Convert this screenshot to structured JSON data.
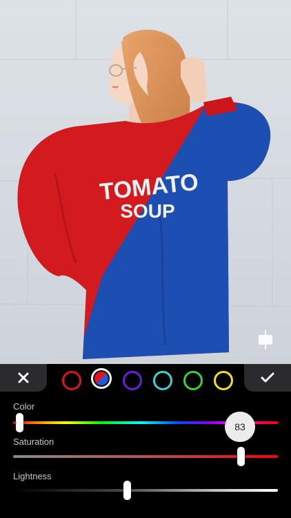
{
  "photo": {
    "description": "",
    "sweatshirt_text_line1": "TOMATO",
    "sweatshirt_text_line2": "SOUP",
    "original_color": "#d21a1f",
    "recolor_color": "#1d4fb3"
  },
  "toolbar": {
    "cancel_icon": "close-icon",
    "confirm_icon": "checkmark-icon",
    "swatches": [
      {
        "name": "red",
        "color": "#e1141e"
      },
      {
        "name": "red-blue",
        "color": "#1e5bd6",
        "selected": true
      },
      {
        "name": "purple",
        "color": "#6a1fd6"
      },
      {
        "name": "cyan",
        "color": "#36d6d0"
      },
      {
        "name": "green",
        "color": "#3ad03e"
      },
      {
        "name": "yellow",
        "color": "#f0e21a"
      }
    ]
  },
  "sliders": {
    "color": {
      "label": "Color",
      "value": 83,
      "value_text": "83",
      "fraction": 0.025
    },
    "saturation": {
      "label": "Saturation",
      "fraction": 0.86
    },
    "lightness": {
      "label": "Lightness",
      "fraction": 0.43
    }
  }
}
